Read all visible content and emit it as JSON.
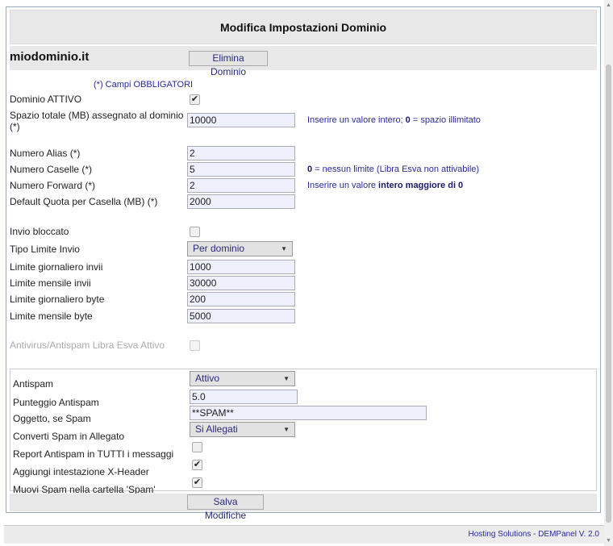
{
  "title": "Modifica Impostazioni Dominio",
  "domain": {
    "name": "miodominio.it",
    "delete_label": "Elimina Dominio"
  },
  "required_note": "(*) Campi OBBLIGATORI",
  "fields": {
    "dominio_attivo": {
      "label": "Dominio ATTIVO",
      "checked": true
    },
    "spazio_totale": {
      "label_line1": "Spazio totale (MB) assegnato al dominio",
      "label_line2": "(*)",
      "value": "10000"
    },
    "spazio_hint_pre": "Inserire un valore intero; ",
    "spazio_hint_bold": "0",
    "spazio_hint_post": " = spazio illimitato",
    "numero_alias": {
      "label": "Numero Alias (*)",
      "value": "2"
    },
    "numero_caselle": {
      "label": "Numero Caselle (*)",
      "value": "5"
    },
    "caselle_hint_bold": "0",
    "caselle_hint_post": " = nessun limite (Libra Esva non attivabile)",
    "numero_forward": {
      "label": "Numero Forward (*)",
      "value": "2"
    },
    "forward_hint_pre": "Inserire un valore ",
    "forward_hint_bold": "intero maggiore di 0",
    "default_quota": {
      "label": "Default Quota per Casella (MB) (*)",
      "value": "2000"
    },
    "invio_bloccato": {
      "label": "Invio bloccato",
      "checked": false
    },
    "tipo_limite": {
      "label": "Tipo Limite Invio",
      "value": "Per dominio"
    },
    "limite_giornaliero_invii": {
      "label": "Limite giornaliero invii",
      "value": "1000"
    },
    "limite_mensile_invii": {
      "label": "Limite mensile invii",
      "value": "30000"
    },
    "limite_giornaliero_byte": {
      "label": "Limite giornaliero byte",
      "value": "200"
    },
    "limite_mensile_byte": {
      "label": "Limite mensile byte",
      "value": "5000"
    },
    "antivirus": {
      "label": "Antivirus/Antispam Libra Esva Attivo",
      "checked": false,
      "disabled": true
    }
  },
  "spam": {
    "antispam": {
      "label": "Antispam",
      "value": "Attivo"
    },
    "punteggio": {
      "label": "Punteggio Antispam",
      "value": "5.0"
    },
    "oggetto": {
      "label": "Oggetto, se Spam",
      "value": "**SPAM**"
    },
    "converti": {
      "label": "Converti Spam in Allegato",
      "value": "Si Allegati"
    },
    "report": {
      "label": "Report Antispam in TUTTI i messaggi",
      "checked": false
    },
    "xheader": {
      "label": "Aggiungi intestazione X-Header",
      "checked": true
    },
    "muovi": {
      "label": "Muovi Spam nella cartella 'Spam'",
      "checked": true
    }
  },
  "save_label": "Salva Modifiche",
  "footer": "Hosting Solutions - DEMPanel V. 2.0",
  "colors": {
    "accent": "#2a2a9a",
    "input_bg": "#eef0fc",
    "bar_bg": "#e8e8e8"
  }
}
